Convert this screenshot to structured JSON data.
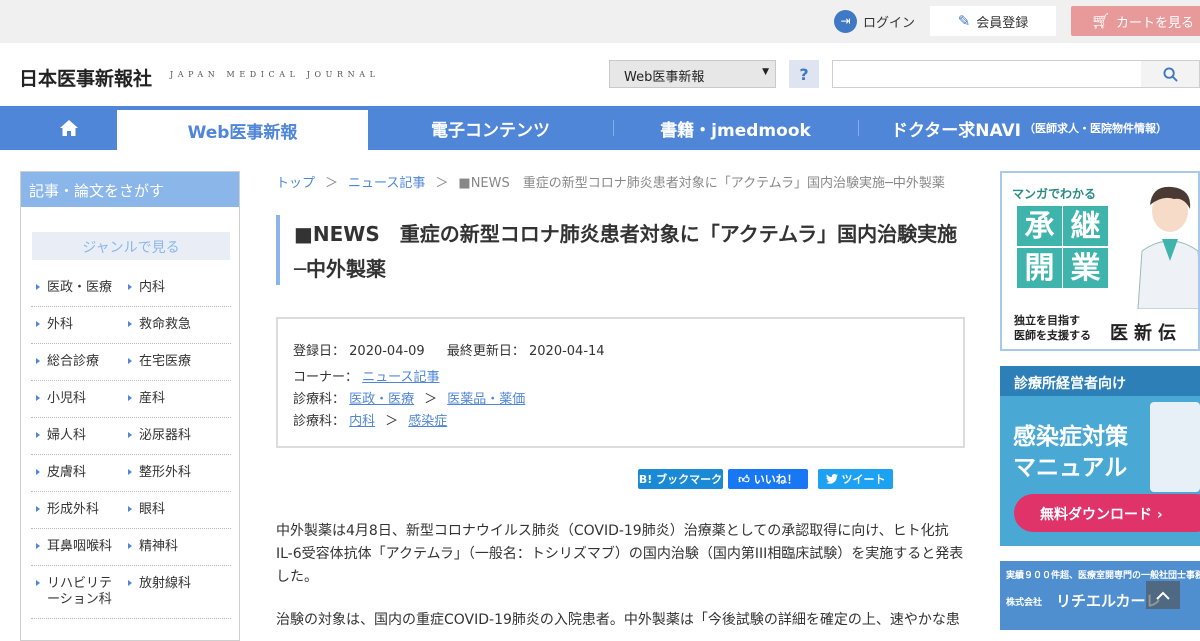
{
  "topbar": {
    "login": "ログイン",
    "register": "会員登録",
    "cart": "カートを見る"
  },
  "header": {
    "logo": "日本医事新報社",
    "logo_sub": "JAPAN MEDICAL JOURNAL",
    "select_value": "Web医事新報",
    "help": "?",
    "search_placeholder": ""
  },
  "nav": {
    "tabs": [
      {
        "label": "Web医事新報"
      },
      {
        "label": "電子コンテンツ"
      },
      {
        "label": "書籍・jmedmook"
      },
      {
        "label": "ドクター求NAVI",
        "sub": "（医師求人・医院物件情報）"
      }
    ]
  },
  "sidebar": {
    "title": "記事・論文をさがす",
    "genre": "ジャンルで見る",
    "items": [
      [
        "医政・医療",
        "内科"
      ],
      [
        "外科",
        "救命救急"
      ],
      [
        "総合診療",
        "在宅医療"
      ],
      [
        "小児科",
        "産科"
      ],
      [
        "婦人科",
        "泌尿器科"
      ],
      [
        "皮膚科",
        "整形外科"
      ],
      [
        "形成外科",
        "眼科"
      ],
      [
        "耳鼻咽喉科",
        "精神科"
      ],
      [
        "リハビリテーション科",
        "放射線科"
      ]
    ]
  },
  "breadcrumb": {
    "top": "トップ",
    "news": "ニュース記事",
    "sep": "＞",
    "current": "■NEWS　重症の新型コロナ肺炎患者対象に「アクテムラ」国内治験実施─中外製薬"
  },
  "article": {
    "title": "■NEWS　重症の新型コロナ肺炎患者対象に「アクテムラ」国内治験実施─中外製薬",
    "registered_label": "登録日：",
    "registered": "2020-04-09",
    "updated_label": "最終更新日：",
    "updated": "2020-04-14",
    "corner_label": "コーナー：",
    "corner": "ニュース記事",
    "dept_label": "診療科：",
    "dept1_a": "医政・医療",
    "dept1_b": "医薬品・薬価",
    "dept2_a": "内科",
    "dept2_b": "感染症",
    "sep": "＞",
    "para1": "中外製薬は4月8日、新型コロナウイルス肺炎（COVID-19肺炎）治療薬としての承認取得に向け、ヒト化抗IL-6受容体抗体「アクテムラ」（一般名：トシリズマブ）の国内治験（国内第III相臨床試験）を実施すると発表した。",
    "para2": "治験の対象は、国内の重症COVID-19肺炎の入院患者。中外製薬は「今後試験の詳細を確定の上、速やかな患"
  },
  "share": {
    "bookmark": "B! ブックマーク",
    "like": "いいね！",
    "tweet": "ツイート"
  },
  "banners": {
    "b1_top": "マンガでわかる",
    "b1_chars": [
      "承",
      "継",
      "開",
      "業"
    ],
    "b1_sub1": "独立を目指す",
    "b1_sub2": "医師を支援する",
    "b1_brand": "医新伝",
    "b2_head": "診療所経営者向け",
    "b2_line1": "感染症対策",
    "b2_line2": "マニュアル",
    "b2_cta": "無料ダウンロード ›",
    "b3_line1": "実績９００件超、医療室開専門の一般社団士事務所",
    "b3_line2": "株式会社",
    "b3_name": "リチエルカーレ"
  }
}
